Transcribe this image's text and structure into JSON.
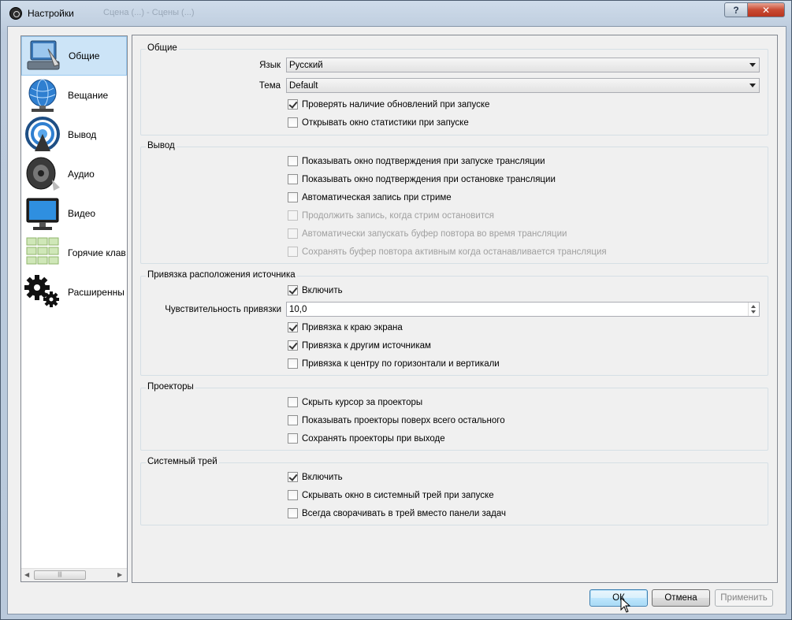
{
  "window": {
    "title": "Настройки",
    "background_title": "Сцена (...) - Сцены (...)"
  },
  "sidebar": {
    "items": [
      {
        "label": "Общие",
        "icon": "general-settings-icon"
      },
      {
        "label": "Вещание",
        "icon": "broadcast-globe-icon"
      },
      {
        "label": "Вывод",
        "icon": "output-antenna-icon"
      },
      {
        "label": "Аудио",
        "icon": "speaker-icon"
      },
      {
        "label": "Видео",
        "icon": "monitor-icon"
      },
      {
        "label": "Горячие клав",
        "icon": "hotkeys-icon"
      },
      {
        "label": "Расширенны",
        "icon": "gears-icon"
      }
    ],
    "selected_index": 0
  },
  "general": {
    "title": "Общие",
    "language_label": "Язык",
    "language_value": "Русский",
    "theme_label": "Тема",
    "theme_value": "Default",
    "check_updates": {
      "label": "Проверять наличие обновлений при запуске",
      "checked": true
    },
    "open_stats": {
      "label": "Открывать окно статистики при запуске",
      "checked": false
    }
  },
  "output": {
    "title": "Вывод",
    "items": [
      {
        "label": "Показывать окно подтверждения при запуске трансляции",
        "checked": false,
        "enabled": true
      },
      {
        "label": "Показывать окно подтверждения при остановке трансляции",
        "checked": false,
        "enabled": true
      },
      {
        "label": "Автоматическая запись при стриме",
        "checked": false,
        "enabled": true
      },
      {
        "label": "Продолжить запись, когда стрим остановится",
        "checked": false,
        "enabled": false
      },
      {
        "label": "Автоматически запускать буфер повтора во время трансляции",
        "checked": false,
        "enabled": false
      },
      {
        "label": "Сохранять буфер повтора активным когда останавливается трансляция",
        "checked": false,
        "enabled": false
      }
    ]
  },
  "snapping": {
    "title": "Привязка расположения источника",
    "enable": {
      "label": "Включить",
      "checked": true
    },
    "sensitivity_label": "Чувствительность привязки",
    "sensitivity_value": "10,0",
    "items": [
      {
        "label": "Привязка к краю экрана",
        "checked": true
      },
      {
        "label": "Привязка к другим источникам",
        "checked": true
      },
      {
        "label": "Привязка к центру по горизонтали и вертикали",
        "checked": false
      }
    ]
  },
  "projectors": {
    "title": "Проекторы",
    "items": [
      {
        "label": "Скрыть курсор за проекторы",
        "checked": false
      },
      {
        "label": "Показывать проекторы поверх всего остального",
        "checked": false
      },
      {
        "label": "Сохранять проекторы при выходе",
        "checked": false
      }
    ]
  },
  "tray": {
    "title": "Системный трей",
    "items": [
      {
        "label": "Включить",
        "checked": true
      },
      {
        "label": "Скрывать окно в системный трей при запуске",
        "checked": false
      },
      {
        "label": "Всегда сворачивать в трей вместо панели задач",
        "checked": false
      }
    ]
  },
  "buttons": {
    "ok": "ОК",
    "cancel": "Отмена",
    "apply": "Применить"
  },
  "window_buttons": {
    "help": "?",
    "close": "✕"
  }
}
